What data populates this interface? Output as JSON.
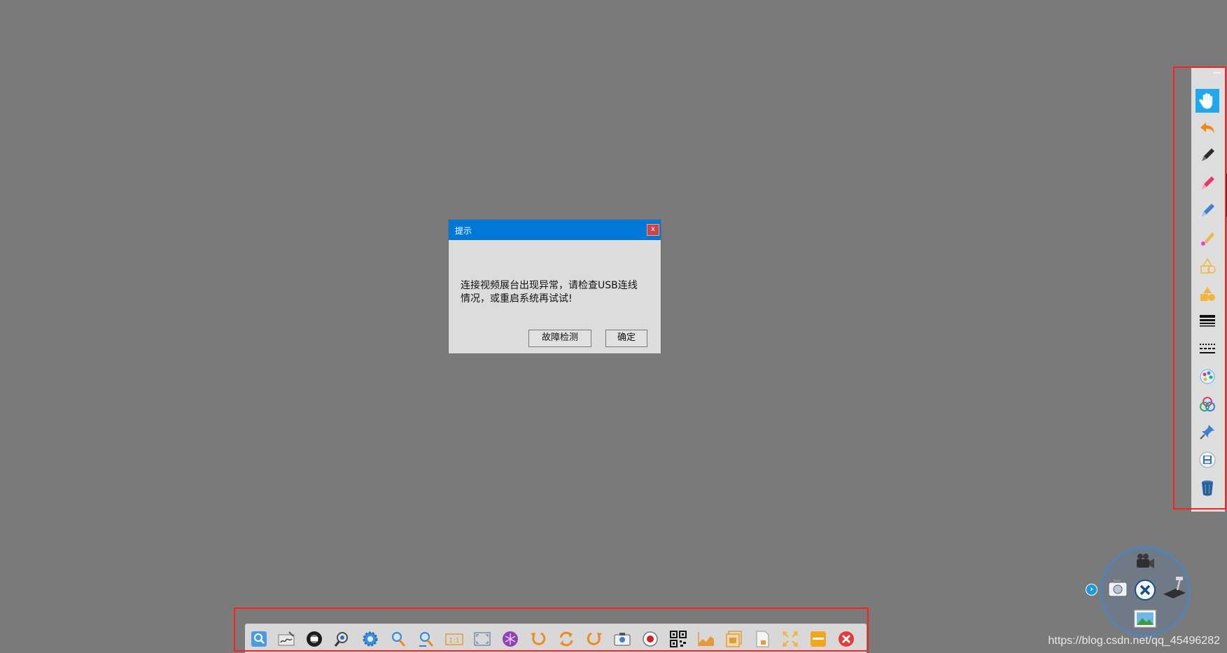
{
  "dialog": {
    "title": "提示",
    "close_label": "x",
    "message_line1": "连接视频展台出现异常，请检查USB连线",
    "message_line2": "情况，或重启系统再试试!",
    "diagnose_label": "故障检测",
    "ok_label": "确定"
  },
  "side_toolbar": {
    "tools": [
      {
        "icon": "hand-icon"
      },
      {
        "icon": "undo-icon"
      },
      {
        "icon": "pen-black-icon"
      },
      {
        "icon": "pen-red-icon"
      },
      {
        "icon": "pen-blue-icon"
      },
      {
        "icon": "laser-pen-icon"
      },
      {
        "icon": "shape-outline-icon"
      },
      {
        "icon": "shape-fill-icon"
      },
      {
        "icon": "line-width-icon"
      },
      {
        "icon": "line-style-icon"
      },
      {
        "icon": "palette-icon"
      },
      {
        "icon": "color-mix-icon"
      },
      {
        "icon": "pin-icon"
      },
      {
        "icon": "save-icon"
      },
      {
        "icon": "trash-icon"
      }
    ]
  },
  "bottom_toolbar": {
    "tools": [
      {
        "icon": "search-icon"
      },
      {
        "icon": "signature-icon"
      },
      {
        "icon": "film-icon"
      },
      {
        "icon": "zoom-camera-icon"
      },
      {
        "icon": "settings-gear-icon"
      },
      {
        "icon": "zoom-in-icon"
      },
      {
        "icon": "zoom-out-icon"
      },
      {
        "icon": "one-to-one-icon",
        "text": "1:1"
      },
      {
        "icon": "fit-screen-icon"
      },
      {
        "icon": "snowflake-icon"
      },
      {
        "icon": "rotate-left-icon"
      },
      {
        "icon": "refresh-icon"
      },
      {
        "icon": "rotate-right-icon"
      },
      {
        "icon": "camera-icon"
      },
      {
        "icon": "record-icon"
      },
      {
        "icon": "qrcode-icon"
      },
      {
        "icon": "chart-icon"
      },
      {
        "icon": "image-gallery-icon"
      },
      {
        "icon": "document-icon"
      },
      {
        "icon": "fullscreen-icon"
      },
      {
        "icon": "minimize-icon"
      },
      {
        "icon": "close-icon"
      }
    ]
  },
  "camera_wheel": {
    "items": [
      "video-camera-icon",
      "photo-camera-icon",
      "close-icon",
      "document-camera-icon",
      "gallery-icon"
    ]
  },
  "watermark": "https://blog.csdn.net/qq_45496282",
  "colors": {
    "background": "#7a7a7a",
    "titlebar": "#0078d7",
    "highlight": "#ff1f1f"
  }
}
